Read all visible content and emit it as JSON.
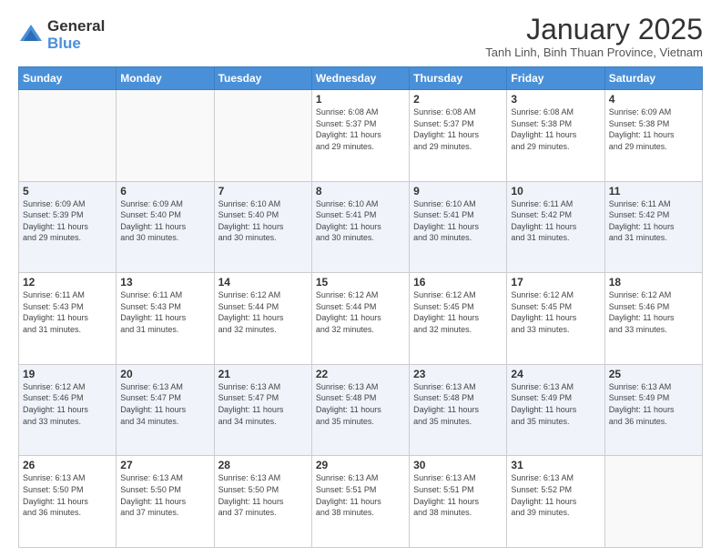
{
  "logo": {
    "general": "General",
    "blue": "Blue"
  },
  "header": {
    "month": "January 2025",
    "location": "Tanh Linh, Binh Thuan Province, Vietnam"
  },
  "days_header": [
    "Sunday",
    "Monday",
    "Tuesday",
    "Wednesday",
    "Thursday",
    "Friday",
    "Saturday"
  ],
  "weeks": [
    [
      {
        "day": "",
        "info": ""
      },
      {
        "day": "",
        "info": ""
      },
      {
        "day": "",
        "info": ""
      },
      {
        "day": "1",
        "info": "Sunrise: 6:08 AM\nSunset: 5:37 PM\nDaylight: 11 hours\nand 29 minutes."
      },
      {
        "day": "2",
        "info": "Sunrise: 6:08 AM\nSunset: 5:37 PM\nDaylight: 11 hours\nand 29 minutes."
      },
      {
        "day": "3",
        "info": "Sunrise: 6:08 AM\nSunset: 5:38 PM\nDaylight: 11 hours\nand 29 minutes."
      },
      {
        "day": "4",
        "info": "Sunrise: 6:09 AM\nSunset: 5:38 PM\nDaylight: 11 hours\nand 29 minutes."
      }
    ],
    [
      {
        "day": "5",
        "info": "Sunrise: 6:09 AM\nSunset: 5:39 PM\nDaylight: 11 hours\nand 29 minutes."
      },
      {
        "day": "6",
        "info": "Sunrise: 6:09 AM\nSunset: 5:40 PM\nDaylight: 11 hours\nand 30 minutes."
      },
      {
        "day": "7",
        "info": "Sunrise: 6:10 AM\nSunset: 5:40 PM\nDaylight: 11 hours\nand 30 minutes."
      },
      {
        "day": "8",
        "info": "Sunrise: 6:10 AM\nSunset: 5:41 PM\nDaylight: 11 hours\nand 30 minutes."
      },
      {
        "day": "9",
        "info": "Sunrise: 6:10 AM\nSunset: 5:41 PM\nDaylight: 11 hours\nand 30 minutes."
      },
      {
        "day": "10",
        "info": "Sunrise: 6:11 AM\nSunset: 5:42 PM\nDaylight: 11 hours\nand 31 minutes."
      },
      {
        "day": "11",
        "info": "Sunrise: 6:11 AM\nSunset: 5:42 PM\nDaylight: 11 hours\nand 31 minutes."
      }
    ],
    [
      {
        "day": "12",
        "info": "Sunrise: 6:11 AM\nSunset: 5:43 PM\nDaylight: 11 hours\nand 31 minutes."
      },
      {
        "day": "13",
        "info": "Sunrise: 6:11 AM\nSunset: 5:43 PM\nDaylight: 11 hours\nand 31 minutes."
      },
      {
        "day": "14",
        "info": "Sunrise: 6:12 AM\nSunset: 5:44 PM\nDaylight: 11 hours\nand 32 minutes."
      },
      {
        "day": "15",
        "info": "Sunrise: 6:12 AM\nSunset: 5:44 PM\nDaylight: 11 hours\nand 32 minutes."
      },
      {
        "day": "16",
        "info": "Sunrise: 6:12 AM\nSunset: 5:45 PM\nDaylight: 11 hours\nand 32 minutes."
      },
      {
        "day": "17",
        "info": "Sunrise: 6:12 AM\nSunset: 5:45 PM\nDaylight: 11 hours\nand 33 minutes."
      },
      {
        "day": "18",
        "info": "Sunrise: 6:12 AM\nSunset: 5:46 PM\nDaylight: 11 hours\nand 33 minutes."
      }
    ],
    [
      {
        "day": "19",
        "info": "Sunrise: 6:12 AM\nSunset: 5:46 PM\nDaylight: 11 hours\nand 33 minutes."
      },
      {
        "day": "20",
        "info": "Sunrise: 6:13 AM\nSunset: 5:47 PM\nDaylight: 11 hours\nand 34 minutes."
      },
      {
        "day": "21",
        "info": "Sunrise: 6:13 AM\nSunset: 5:47 PM\nDaylight: 11 hours\nand 34 minutes."
      },
      {
        "day": "22",
        "info": "Sunrise: 6:13 AM\nSunset: 5:48 PM\nDaylight: 11 hours\nand 35 minutes."
      },
      {
        "day": "23",
        "info": "Sunrise: 6:13 AM\nSunset: 5:48 PM\nDaylight: 11 hours\nand 35 minutes."
      },
      {
        "day": "24",
        "info": "Sunrise: 6:13 AM\nSunset: 5:49 PM\nDaylight: 11 hours\nand 35 minutes."
      },
      {
        "day": "25",
        "info": "Sunrise: 6:13 AM\nSunset: 5:49 PM\nDaylight: 11 hours\nand 36 minutes."
      }
    ],
    [
      {
        "day": "26",
        "info": "Sunrise: 6:13 AM\nSunset: 5:50 PM\nDaylight: 11 hours\nand 36 minutes."
      },
      {
        "day": "27",
        "info": "Sunrise: 6:13 AM\nSunset: 5:50 PM\nDaylight: 11 hours\nand 37 minutes."
      },
      {
        "day": "28",
        "info": "Sunrise: 6:13 AM\nSunset: 5:50 PM\nDaylight: 11 hours\nand 37 minutes."
      },
      {
        "day": "29",
        "info": "Sunrise: 6:13 AM\nSunset: 5:51 PM\nDaylight: 11 hours\nand 38 minutes."
      },
      {
        "day": "30",
        "info": "Sunrise: 6:13 AM\nSunset: 5:51 PM\nDaylight: 11 hours\nand 38 minutes."
      },
      {
        "day": "31",
        "info": "Sunrise: 6:13 AM\nSunset: 5:52 PM\nDaylight: 11 hours\nand 39 minutes."
      },
      {
        "day": "",
        "info": ""
      }
    ]
  ]
}
